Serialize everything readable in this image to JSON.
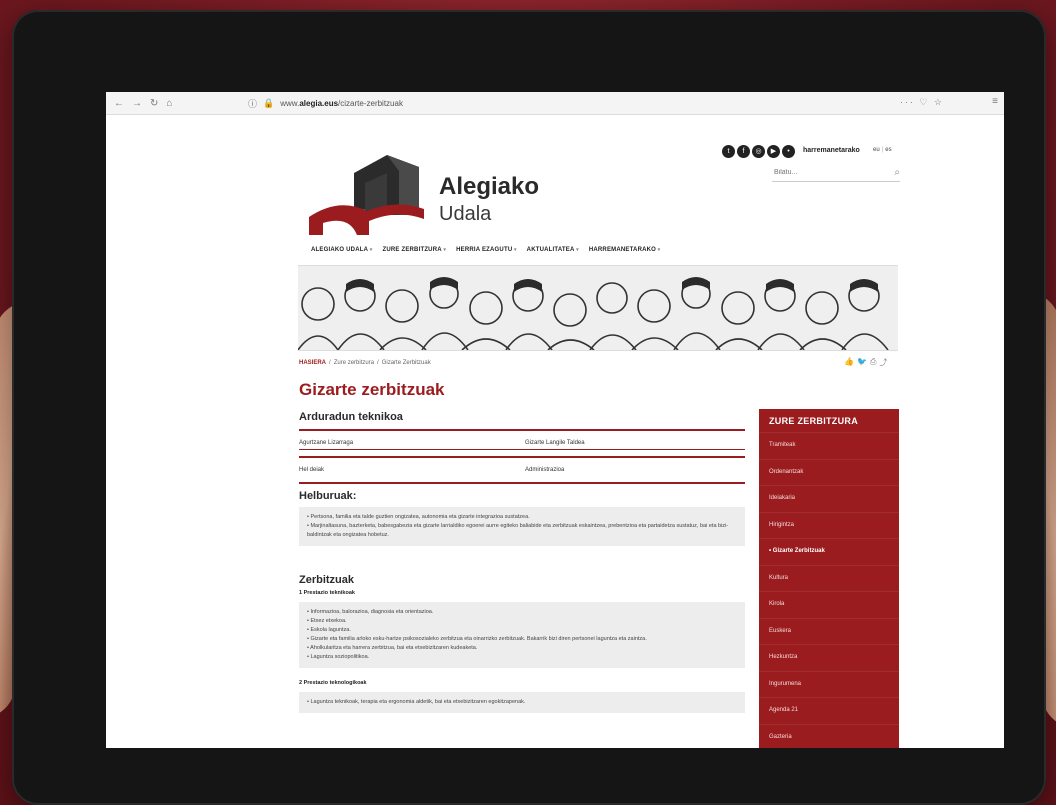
{
  "browser": {
    "url_prefix": "www.",
    "url_domain": "alegia.eus",
    "url_path": "/cizarte-zerbitzuak",
    "zoom_icons": "··· ♡ ☆"
  },
  "header": {
    "brand_title": "Alegiako",
    "brand_subtitle": "Udala",
    "contact_link": "harremanetarako",
    "languages": [
      "eu",
      "es"
    ],
    "search_placeholder": "Bilatu..."
  },
  "nav": {
    "items": [
      "ALEGIAKO UDALA",
      "ZURE ZERBITZURA",
      "HERRIA EZAGUTU",
      "AKTUALITATEA",
      "HARREMANETARAKO"
    ]
  },
  "breadcrumb": {
    "home": "HASIERA",
    "level1": "Zure zerbitzura",
    "level2": "Gizarte Zerbitzuak"
  },
  "page": {
    "title": "Gizarte zerbitzuak",
    "responsible_heading": "Arduradun teknikoa",
    "contacts": [
      {
        "left": "Agurtzane Lizarraga",
        "right": "Gizarte Langile Taldea"
      },
      {
        "left": "Hel deiak",
        "right": "Administrazioa"
      }
    ],
    "goals_heading": "Helburuak:",
    "goals": [
      "Pertsona, familia eta talde guztien ongizatea, autonomia eta gizarte integrazioa sustatzea.",
      "Marjinaltasuna, bazterketa, babesgabezia eta gizarte larrialdiko egoerei aurre egiteko baliabide eta zerbitzuak eskaintzea, prebentzioa eta partaidetza sustatuz, bai eta bizi-baldintzak eta ongizatea hobetuz."
    ],
    "services_heading": "Zerbitzuak",
    "service_group1_title": "1 Prestazio teknikoak",
    "service_group1": [
      "Informazioa, balorazioa, diagnosia eta orientazioa.",
      "Etxez etxekoa.",
      "Eskola laguntza.",
      "Gizarte eta familia arloko esku-hartze psikosozialeko zerbitzua eta oinarrizko zerbitzuak. Bakarrik bizi diren pertsonei laguntza eta zaintza.",
      "Aholkularitza eta harrera zerbitzua, bai eta etxebizitzaren kudeaketa.",
      "Laguntza soziopolitikoa."
    ],
    "service_group2_title": "2 Prestazio teknologikoak",
    "service_group2": [
      "Laguntza teknikoak, terapia eta ergonomia aldetik, bai eta etxebizitzaren egokitzapenak."
    ]
  },
  "sidebar": {
    "title": "ZURE ZERBITZURA",
    "items": [
      "Tramiteak",
      "Ordenantzak",
      "Ideiakaria",
      "Hirigintza",
      "Gizarte Zerbitzuak",
      "Kultura",
      "Kirola",
      "Euskera",
      "Hezkuntza",
      "Ingurumena",
      "Agenda 21",
      "Gazteria"
    ],
    "active_index": 4
  },
  "colors": {
    "accent": "#9b1c1f",
    "background": "#7a1c24"
  }
}
